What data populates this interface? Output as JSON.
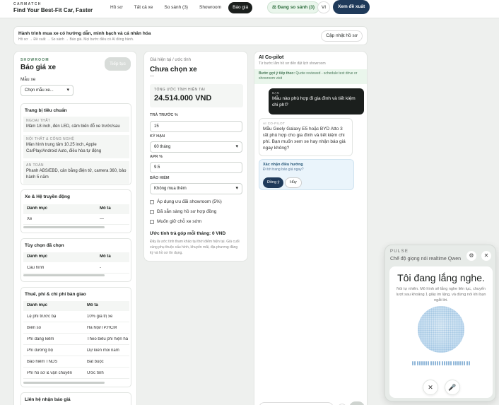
{
  "app": {
    "brand_small": "CARMATCH",
    "brand_main": "Find Your Best-Fit Car, Faster"
  },
  "nav": [
    {
      "label": "Hồ sơ",
      "active": false
    },
    {
      "label": "Tất cả xe",
      "active": false
    },
    {
      "label": "So sánh (3)",
      "active": false
    },
    {
      "label": "Showroom",
      "active": false
    },
    {
      "label": "Báo giá",
      "active": true
    }
  ],
  "header": {
    "compare_label": "Đang so sánh (3)",
    "lang": "VI",
    "cta": "Xem đề xuất"
  },
  "journey": {
    "title": "Hành trình mua xe có hướng dẫn, minh bạch và cá nhân hóa",
    "subtitle": "Hồ sơ → Đề xuất → So sánh → Báo giá. Mọi bước điều có AI đồng hành.",
    "button": "Cập nhật hồ sơ"
  },
  "quote": {
    "eyebrow": "SHOWROOM",
    "title": "Báo giá xe",
    "next_button": "Tiếp tục",
    "model_label": "Mẫu xe",
    "model_placeholder": "Chọn mẫu xe...",
    "equipment": {
      "title": "Trang bị tiêu chuẩn",
      "items": [
        {
          "key": "NGOẠI THẤT",
          "value": "Mâm 18 inch, đèn LED, cảm biến đỗ xe trước/sau"
        },
        {
          "key": "NỘI THẤT & CÔNG NGHỆ",
          "value": "Màn hình trung tâm 10.25 inch, Apple CarPlay/Android Auto, điều hòa tự động"
        },
        {
          "key": "AN TOÀN",
          "value": "Phanh ABS/EBD, cân bằng điện tử, camera 360, bảo hành 5 năm"
        }
      ]
    },
    "vehicle": {
      "title": "Xe & Hệ truyền động",
      "col1": "Danh mục",
      "col2": "Mô tả",
      "rows": [
        {
          "c1": "Xe",
          "c2": "—"
        }
      ]
    },
    "options": {
      "title": "Tùy chọn đã chọn",
      "col1": "Danh mục",
      "col2": "Mô tả",
      "rows": [
        {
          "c1": "Cấu hình",
          "c2": "-"
        }
      ]
    },
    "fees": {
      "title": "Thuế, phí & chi phí bàn giao",
      "col1": "Danh mục",
      "col2": "Mô tả",
      "rows": [
        {
          "c1": "Lệ phí trước bạ",
          "c2": "10% giá trị xe"
        },
        {
          "c1": "Biển số",
          "c2": "Hà Nội/TP.HCM"
        },
        {
          "c1": "Phí đăng kiểm",
          "c2": "Theo biểu phí hiện hà"
        },
        {
          "c1": "Phí đường bộ",
          "c2": "Dự kiến mỗi năm"
        },
        {
          "c1": "Bảo hiểm TNDS",
          "c2": "Bắt buộc"
        },
        {
          "c1": "Phí hồ sơ & vận chuyển",
          "c2": "Ước tính"
        }
      ]
    },
    "contact_title": "Liên hệ nhận báo giá"
  },
  "summary": {
    "eyebrow": "Giá hiện tại / ước tính",
    "title": "Chưa chọn xe",
    "dash": "—",
    "total_label": "TỔNG ƯỚC TÍNH HIỆN TẠI",
    "total_value": "24.514.000 VND",
    "down_label": "TRẢ TRƯỚC %",
    "down_value": "15",
    "term_label": "KỲ HẠN",
    "term_value": "60 tháng",
    "apr_label": "APR %",
    "apr_value": "9.5",
    "insurance_label": "BẢO HIỂM",
    "insurance_value": "Không mua thêm",
    "checks": [
      "Áp dụng ưu đãi showroom (5%)",
      "Đã sẵn sàng hồ sơ hợp đồng",
      "Muốn giữ chỗ xe sớm"
    ],
    "monthly": "Ước tính trả góp mỗi tháng: 0 VND",
    "disclaimer": "Đây là ước tính tham khảo tại thời điểm hiện tại. Giá cuối cùng phụ thuộc cấu hình, khuyến mãi, địa phương đăng ký và hồ sơ tín dụng."
  },
  "copilot": {
    "title": "AI Co-pilot",
    "subtitle": "Từ bước lắm hồ sơ đến đặt lịch showroom",
    "next_step_label": "Bước gợi ý tiếp theo:",
    "next_step_text": "Quote reviewed - schedule test drive or showroom visit",
    "user_label": "BẠN",
    "user_msg": "Mẫu nào phù hợp đi gia đình và tiết kiệm chi phí?",
    "ai_label": "AI CO-PILOT",
    "ai_msg": "Mẫu Geely Galaxy E5 hoặc BYD Atto 3 rất phù hợp cho gia đình và tiết kiệm chi phí. Bạn muốn xem xe hay nhận báo giá ngay không?",
    "confirm_title": "Xác nhận điều hướng",
    "confirm_sub": "Đi tới trang báo giá ngay?",
    "yes": "Đồng ý",
    "no": "Hủy"
  },
  "pulse": {
    "brand": "PULSE",
    "mode": "Chế độ giọng nói realtime Qwen",
    "heading": "Tôi đang lắng nghe.",
    "desc": "Nói tự nhiên. Mô hình sẽ lắng nghe liên tục, chuyển lượt sau khoảng 1 giây im lặng, và dừng nói khi bạn ngắt lời.",
    "icons": [
      "settings-icon",
      "close-icon",
      "microphone-icon"
    ]
  }
}
